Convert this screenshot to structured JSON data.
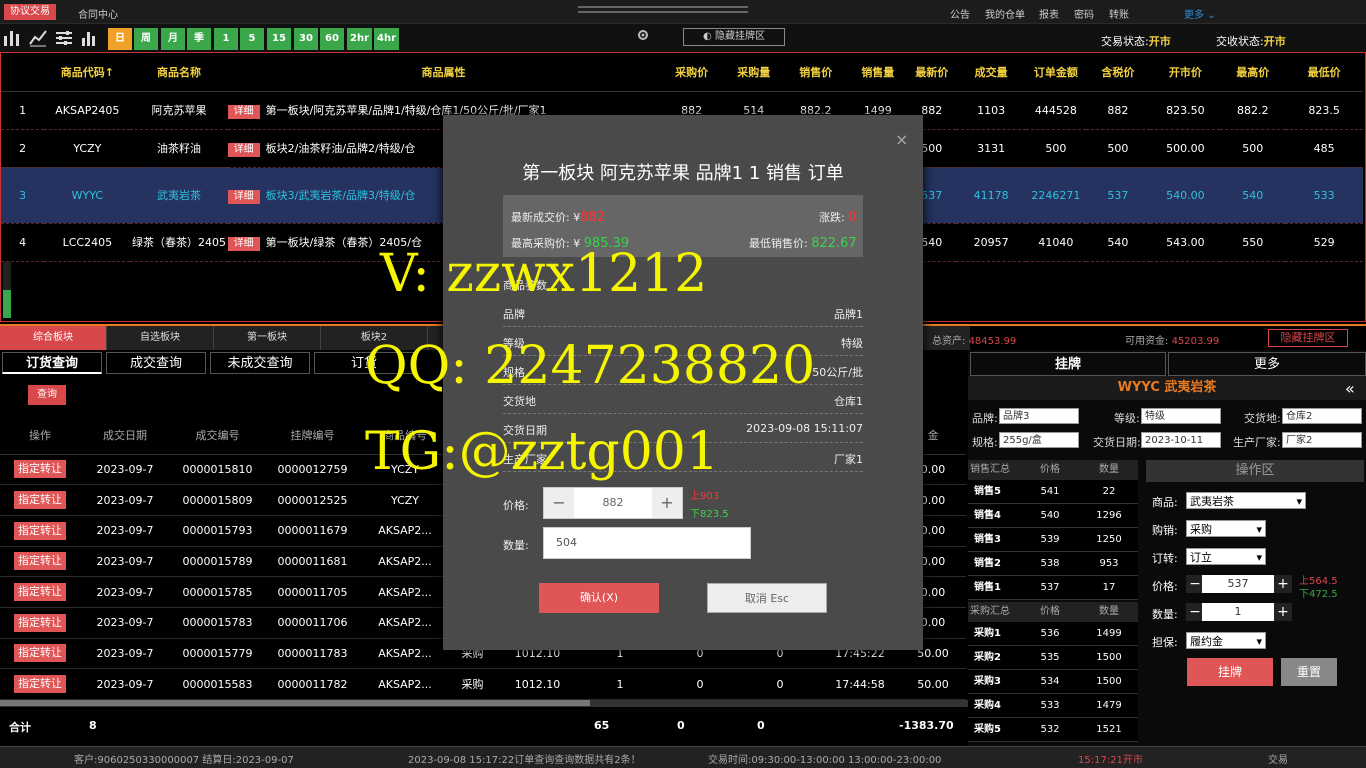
{
  "topbar": {
    "logo": "协议交易",
    "contract_center": "合同中心",
    "links": [
      "公告",
      "我的仓单",
      "报表",
      "密码",
      "转账"
    ],
    "more": "更多"
  },
  "toolbar": {
    "timeframes": [
      "日",
      "周",
      "月",
      "季",
      "1",
      "5",
      "15",
      "30",
      "60",
      "2hr",
      "4hr"
    ],
    "hide_board": "隐藏挂牌区",
    "trade_status_label": "交易状态:",
    "trade_status_value": "开市",
    "delivery_status_label": "交收状态:",
    "delivery_status_value": "开市"
  },
  "market": {
    "headers": [
      "商品代码↑",
      "商品名称",
      "商品属性",
      "采购价",
      "采购量",
      "销售价",
      "销售量",
      "最新价",
      "成交量",
      "订单金额",
      "含税价",
      "开市价",
      "最高价",
      "最低价"
    ],
    "detail_label": "详细",
    "rows": [
      {
        "idx": "1",
        "code": "AKSAP2405",
        "name": "阿克苏苹果",
        "attr": "第一板块/阿克苏苹果/品牌1/特级/仓库1/50公斤/批/厂家1",
        "bp": "882",
        "bq": "514",
        "sp": "882.2",
        "sq": "1499",
        "last": "882",
        "vol": "1103",
        "amt": "444528",
        "tax": "882",
        "open": "823.50",
        "high": "882.2",
        "low": "823.5"
      },
      {
        "idx": "2",
        "code": "YCZY",
        "name": "油茶籽油",
        "attr": "板块2/油茶籽油/品牌2/特级/仓",
        "bp": "",
        "bq": "",
        "sp": "",
        "sq": "",
        "last": "500",
        "vol": "3131",
        "amt": "500",
        "tax": "500",
        "open": "500.00",
        "high": "500",
        "low": "485"
      },
      {
        "idx": "3",
        "code": "WYYC",
        "name": "武夷岩茶",
        "attr": "板块3/武夷岩茶/品牌3/特级/仓",
        "bp": "",
        "bq": "",
        "sp": "",
        "sq": "",
        "last": "537",
        "vol": "41178",
        "amt": "2246271",
        "tax": "537",
        "open": "540.00",
        "high": "540",
        "low": "533"
      },
      {
        "idx": "4",
        "code": "LCC2405",
        "name": "绿茶（春茶）2405",
        "attr": "第一板块/绿茶（春茶）2405/仓",
        "bp": "",
        "bq": "",
        "sp": "",
        "sq": "",
        "last": "540",
        "vol": "20957",
        "amt": "41040",
        "tax": "540",
        "open": "543.00",
        "high": "550",
        "low": "529"
      }
    ]
  },
  "boards": {
    "tabs": [
      "综合板块",
      "自选板块",
      "第一板块",
      "板块2"
    ],
    "total_assets_label": "总资产:",
    "total_assets": "48453.99",
    "available_label": "可用资金:",
    "available": "45203.99",
    "hide_board": "隐藏挂牌区"
  },
  "query": {
    "tabs": [
      "订货查询",
      "成交查询",
      "未成交查询",
      "订货"
    ],
    "query_btn": "查询",
    "headers": [
      "操作",
      "成交日期",
      "成交编号",
      "挂牌编号",
      "商品编号",
      "",
      "",
      "",
      "",
      "",
      "",
      "金"
    ],
    "transfer_label": "指定转让",
    "rows": [
      {
        "date": "2023-09-7",
        "no": "0000015810",
        "list": "0000012759",
        "code": "YCZY",
        "dir": "",
        "price": "",
        "qty": "",
        "c1": "",
        "c2": "",
        "time": "",
        "amt": "0.00"
      },
      {
        "date": "2023-09-7",
        "no": "0000015809",
        "list": "0000012525",
        "code": "YCZY",
        "dir": "",
        "price": "",
        "qty": "",
        "c1": "",
        "c2": "",
        "time": "",
        "amt": "0.00"
      },
      {
        "date": "2023-09-7",
        "no": "0000015793",
        "list": "0000011679",
        "code": "AKSAP2...",
        "dir": "",
        "price": "",
        "qty": "",
        "c1": "",
        "c2": "",
        "time": "",
        "amt": "0.00"
      },
      {
        "date": "2023-09-7",
        "no": "0000015789",
        "list": "0000011681",
        "code": "AKSAP2...",
        "dir": "",
        "price": "",
        "qty": "",
        "c1": "",
        "c2": "",
        "time": "",
        "amt": "0.00"
      },
      {
        "date": "2023-09-7",
        "no": "0000015785",
        "list": "0000011705",
        "code": "AKSAP2...",
        "dir": "",
        "price": "",
        "qty": "",
        "c1": "",
        "c2": "",
        "time": "",
        "amt": "0.00"
      },
      {
        "date": "2023-09-7",
        "no": "0000015783",
        "list": "0000011706",
        "code": "AKSAP2...",
        "dir": "",
        "price": "",
        "qty": "",
        "c1": "",
        "c2": "",
        "time": "",
        "amt": "0.00"
      },
      {
        "date": "2023-09-7",
        "no": "0000015779",
        "list": "0000011783",
        "code": "AKSAP2...",
        "dir": "采购",
        "price": "1012.10",
        "qty": "1",
        "c1": "0",
        "c2": "0",
        "time": "17:45:22",
        "amt": "50.00"
      },
      {
        "date": "2023-09-7",
        "no": "0000015583",
        "list": "0000011782",
        "code": "AKSAP2...",
        "dir": "采购",
        "price": "1012.10",
        "qty": "1",
        "c1": "0",
        "c2": "0",
        "time": "17:44:58",
        "amt": "50.00"
      }
    ],
    "sum_label": "合计",
    "sum_count": "8",
    "sum_qty": "65",
    "sum_c1": "0",
    "sum_c2": "0",
    "sum_amt": "-1383.70"
  },
  "statusbar": {
    "customer": "客户:9060250330000007 结算日:2023-09-07",
    "message": "2023-09-08 15:17:22订单查询查询数据共有2条！",
    "trade_time": "交易时间:09:30:00-13:00:00 13:00:00-23:00:00",
    "clock": "15:17:21开市",
    "mode": "交易"
  },
  "right": {
    "tab_list": "挂牌",
    "tab_more": "更多",
    "title": "WYYC 武夷岩茶",
    "brand_label": "品牌:",
    "brand": "品牌3",
    "grade_label": "等级:",
    "grade": "特级",
    "delivery_label": "交货地:",
    "delivery": "仓库2",
    "spec_label": "规格:",
    "spec": "255g/盒",
    "date_label": "交货日期:",
    "date": "2023-10-11",
    "maker_label": "生产厂家:",
    "maker": "厂家2",
    "sell_head": [
      "销售汇总",
      "价格",
      "数量"
    ],
    "sells": [
      {
        "n": "销售5",
        "p": "541",
        "q": "22"
      },
      {
        "n": "销售4",
        "p": "540",
        "q": "1296"
      },
      {
        "n": "销售3",
        "p": "539",
        "q": "1250"
      },
      {
        "n": "销售2",
        "p": "538",
        "q": "953"
      },
      {
        "n": "销售1",
        "p": "537",
        "q": "17"
      }
    ],
    "buy_head": [
      "采购汇总",
      "价格",
      "数量"
    ],
    "buys": [
      {
        "n": "采购1",
        "p": "536",
        "q": "1499"
      },
      {
        "n": "采购2",
        "p": "535",
        "q": "1500"
      },
      {
        "n": "采购3",
        "p": "534",
        "q": "1500"
      },
      {
        "n": "采购4",
        "p": "533",
        "q": "1479"
      },
      {
        "n": "采购5",
        "p": "532",
        "q": "1521"
      }
    ],
    "op_title": "操作区",
    "goods_label": "商品:",
    "goods": "武夷岩茶",
    "buysell_label": "购销:",
    "buysell": "采购",
    "order_label": "订转:",
    "order": "订立",
    "price_label": "价格:",
    "price": "537",
    "up": "上564.5",
    "down": "下472.5",
    "qty_label": "数量:",
    "qty": "1",
    "guarantee_label": "担保:",
    "guarantee": "履约金",
    "list_btn": "挂牌",
    "reset_btn": "重置"
  },
  "modal": {
    "title": "第一板块 阿克苏苹果 品牌1 1 销售 订单",
    "close": "×",
    "latest_label": "最新成交价: ¥",
    "latest": "882",
    "change_label": "涨跌:",
    "change": "0",
    "highbuy_label": "最高采购价: ¥",
    "highbuy": "985.39",
    "lowsell_label": "最低销售价:",
    "lowsell": "822.67",
    "params_label": "商品参数",
    "params": [
      {
        "k": "品牌",
        "v": "品牌1"
      },
      {
        "k": "等级",
        "v": "特级"
      },
      {
        "k": "规格",
        "v": "50公斤/批"
      },
      {
        "k": "交货地",
        "v": "仓库1"
      },
      {
        "k": "交货日期",
        "v": "2023-09-08 15:11:07"
      },
      {
        "k": "生产厂家",
        "v": "厂家1"
      }
    ],
    "price_label": "价格:",
    "price": "882",
    "up": "上903",
    "down": "下823.5",
    "qty_label": "数量:",
    "qty": "504",
    "confirm": "确认(X)",
    "cancel": "取消 Esc"
  },
  "watermark": {
    "line1": "V: zzwx1212",
    "line2": "QQ: 2247238820",
    "line3": "TG:@zztg001"
  },
  "colors": {
    "accent_red": "#d8474a",
    "green": "#3aa84a",
    "gold": "#f0d040",
    "cyan": "#2ec2dc",
    "selected_row": "#263260"
  }
}
